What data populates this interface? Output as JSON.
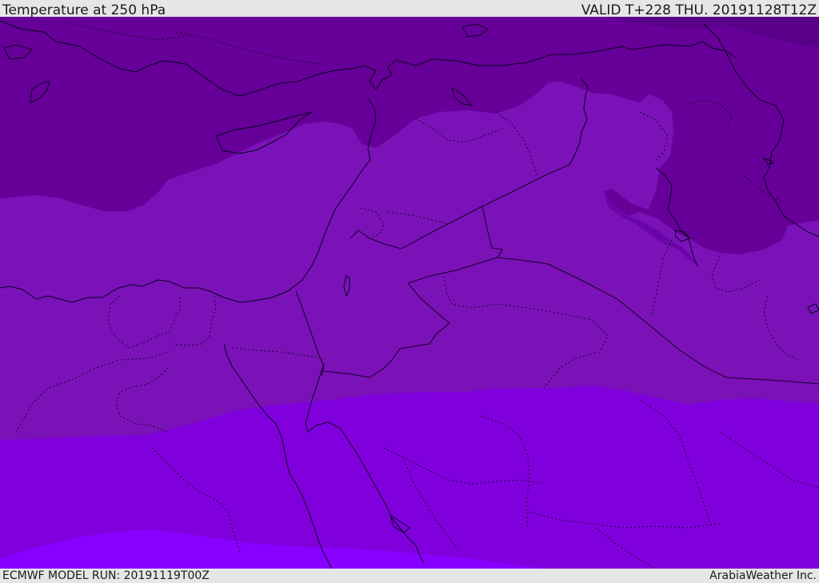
{
  "header": {
    "title": "Temperature at 250 hPa",
    "valid_time": "VALID T+228 THU. 20191128T12Z"
  },
  "footer": {
    "model_run": "ECMWF MODEL RUN: 20191119T00Z",
    "credit": "ArabiaWeather Inc."
  },
  "map": {
    "colors": {
      "coldest_band": "#660099",
      "cold_band": "#7a12b8",
      "mid_band": "#7f00dd",
      "warm_band": "#8800ff",
      "coastline": "#0a0020",
      "borders": "#14002a"
    }
  }
}
